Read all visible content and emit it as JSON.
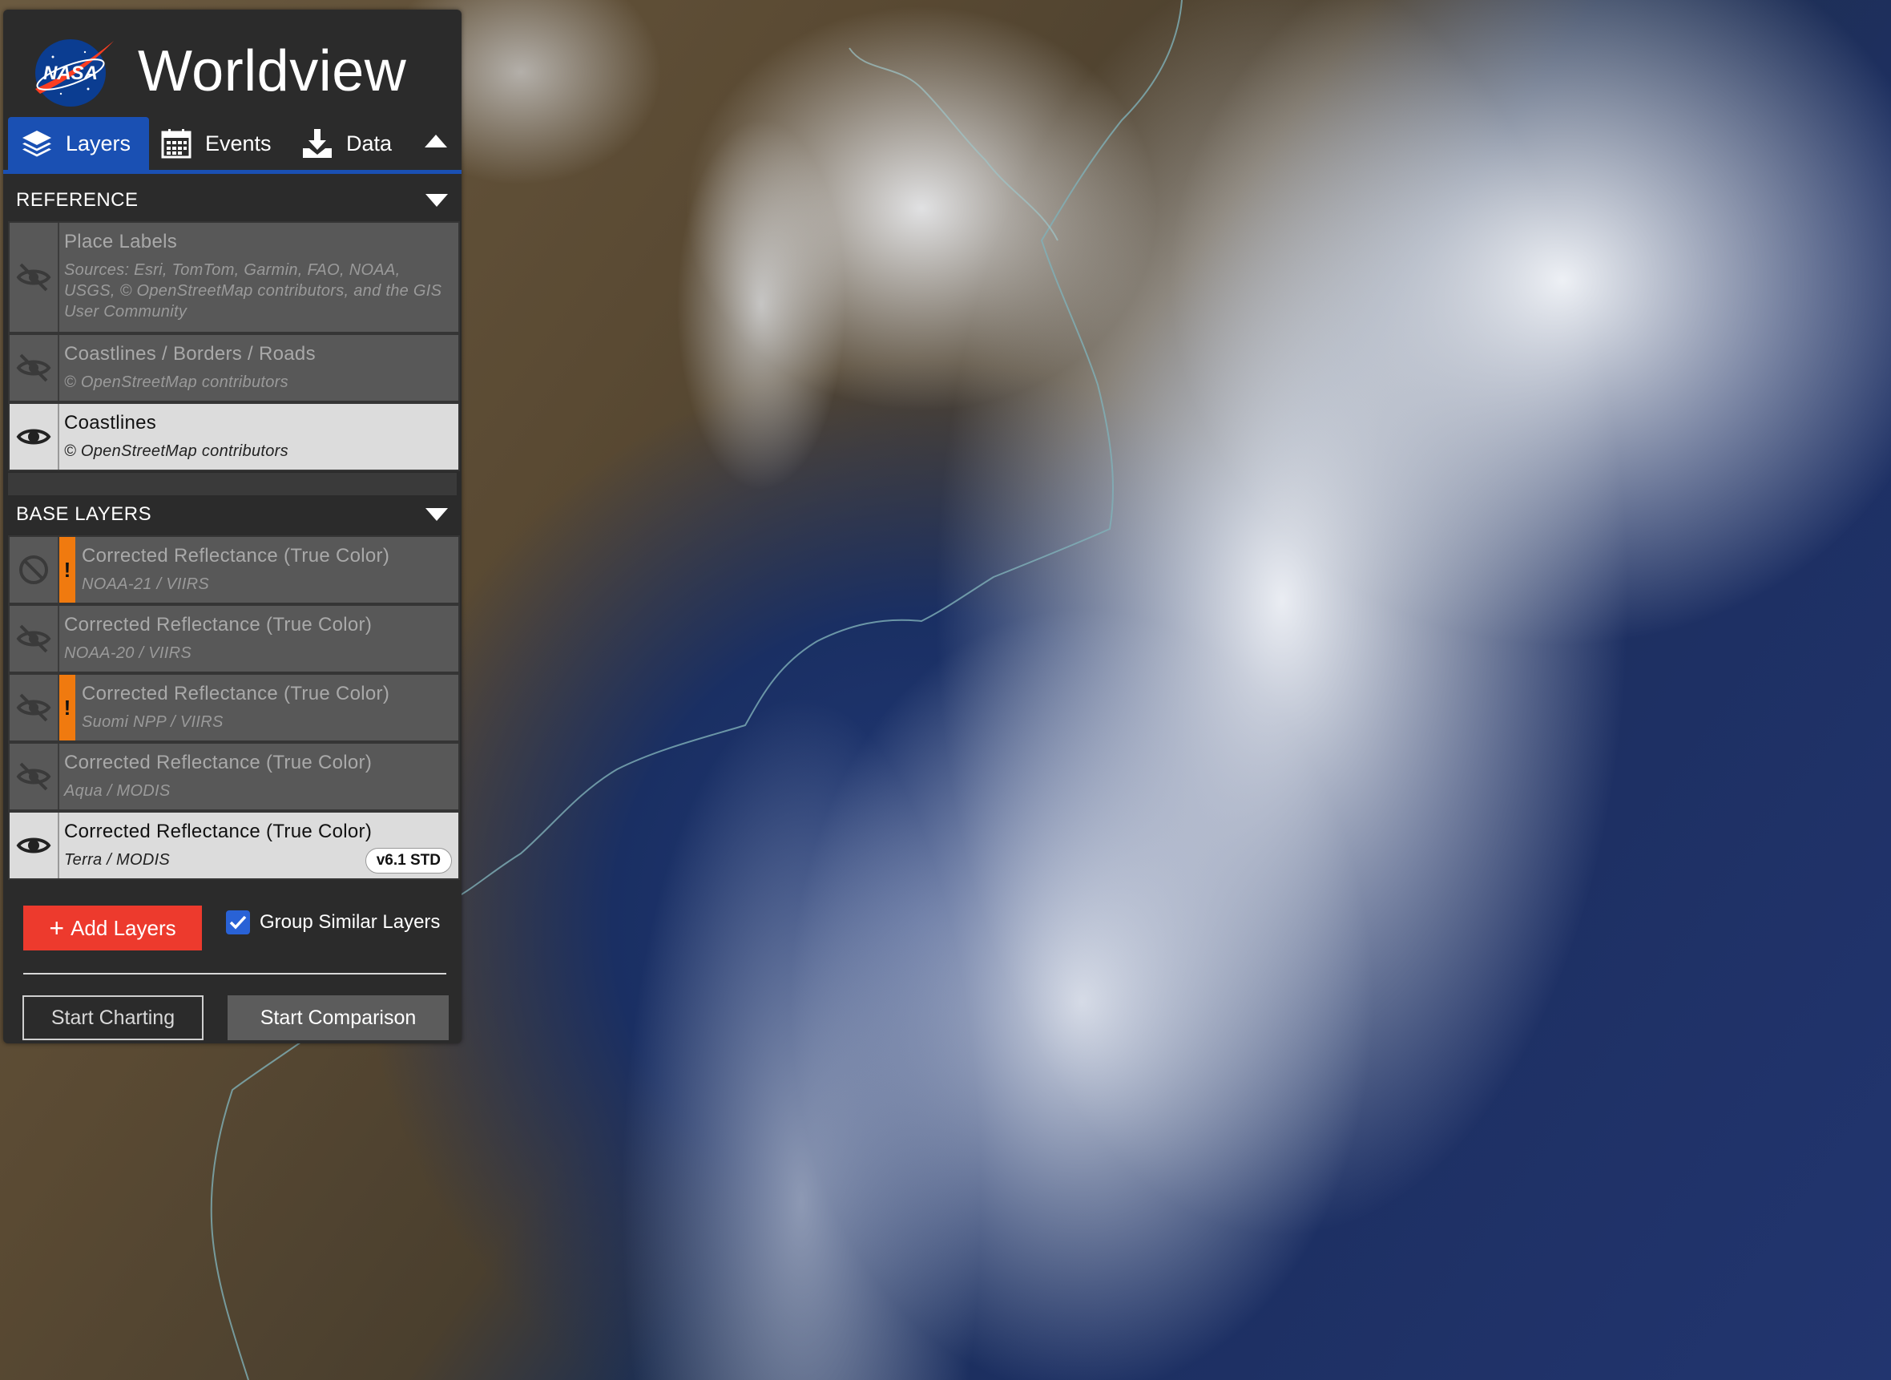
{
  "app": {
    "logo_text": "NASA",
    "title": "Worldview"
  },
  "tabs": [
    {
      "label": "Layers",
      "icon": "layers-icon",
      "active": true
    },
    {
      "label": "Events",
      "icon": "calendar-icon",
      "active": false
    },
    {
      "label": "Data",
      "icon": "download-icon",
      "active": false
    }
  ],
  "sections": {
    "reference": {
      "title": "REFERENCE",
      "layers": [
        {
          "name": "Place Labels",
          "source": "Sources: Esri, TomTom, Garmin, FAO, NOAA, USGS, © OpenStreetMap contributors, and the GIS User Community",
          "visible": false
        },
        {
          "name": "Coastlines / Borders / Roads",
          "source": "© OpenStreetMap contributors",
          "visible": false
        },
        {
          "name": "Coastlines",
          "source": "© OpenStreetMap contributors",
          "visible": true
        }
      ]
    },
    "base": {
      "title": "BASE LAYERS",
      "layers": [
        {
          "name": "Corrected Reflectance (True Color)",
          "source": "NOAA-21 / VIIRS",
          "visible": false,
          "warning": "!"
        },
        {
          "name": "Corrected Reflectance (True Color)",
          "source": "NOAA-20 / VIIRS",
          "visible": false
        },
        {
          "name": "Corrected Reflectance (True Color)",
          "source": "Suomi NPP / VIIRS",
          "visible": false,
          "warning": "!"
        },
        {
          "name": "Corrected Reflectance (True Color)",
          "source": "Aqua / MODIS",
          "visible": false
        },
        {
          "name": "Corrected Reflectance (True Color)",
          "source": "Terra / MODIS",
          "visible": true,
          "badge": "v6.1 STD"
        }
      ]
    }
  },
  "actions": {
    "add_layers": "Add Layers",
    "group_similar": "Group Similar Layers",
    "group_similar_checked": true,
    "start_charting": "Start Charting",
    "start_comparison": "Start Comparison"
  },
  "colors": {
    "accent_blue": "#1a50b3",
    "add_red": "#ed3a2d",
    "warning_orange": "#f07a0f",
    "panel": "#2b2b2b"
  }
}
